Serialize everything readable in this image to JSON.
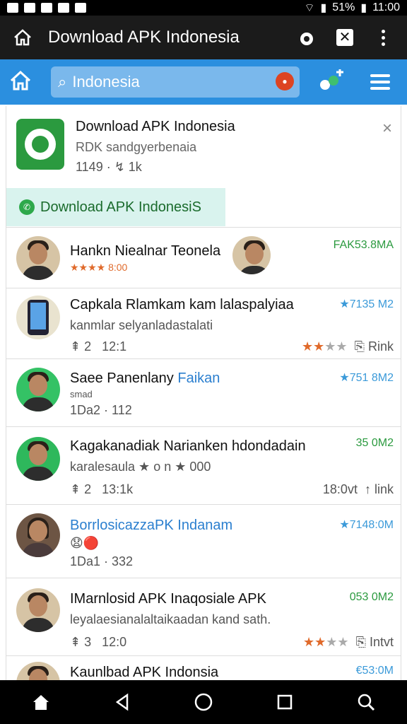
{
  "status": {
    "battery": "51%",
    "time": "11:00"
  },
  "browser": {
    "title": "Download APK Indonesia"
  },
  "search": {
    "placeholder": "Indonesia",
    "value": ""
  },
  "app_card": {
    "title": "Download APK Indonesia",
    "subtitle": "RDK sandgyerbenaia",
    "meta": "1149 · ↯ 1k",
    "download_label": "Download APK IndonesiS"
  },
  "items": [
    {
      "title": "Hankn Niealnar Teonela",
      "sub": "★★★★ 8:00",
      "size": "FAK53.8MA"
    },
    {
      "title": "Capkala Rlamkam kam lalaspalyiaa",
      "sub": "kanmlar selyanladastalati",
      "likes": "2",
      "time": "12:1",
      "size": "★7135 M2",
      "rank": "Rink"
    },
    {
      "title": "Saee Panenlany",
      "title_tail": "Faikan",
      "sub": "smad",
      "meta": "1Da2 · 112",
      "size": "★751 8M2"
    },
    {
      "title": "Kagakanadiak Narianken hdondadain",
      "sub": "karalesaula ★ o n ★ 000",
      "likes": "2",
      "time": "13:1k",
      "time2": "18:0vt",
      "link": "link",
      "size": "35 0M2"
    },
    {
      "title": "BorrlosicazzaPK Indanam",
      "meta": "1Da1 · 332",
      "size": "★7148:0M"
    },
    {
      "title": "IMarnlosid APK Inaqosiale APK",
      "sub": "leyalaesianalaltaikaadan kand sath.",
      "likes": "3",
      "time": "12:0",
      "rank": "Intvt",
      "size": "053 0M2"
    },
    {
      "title": "Kaunlbad APK Indonsia",
      "size": "€53:0M"
    }
  ]
}
